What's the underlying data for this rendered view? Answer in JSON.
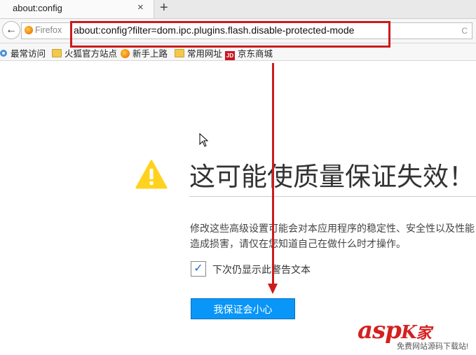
{
  "tab": {
    "title": "about:config",
    "close_glyph": "×",
    "new_tab_glyph": "+"
  },
  "navbar": {
    "back_glyph": "←",
    "identity_label": "Firefox",
    "url": "about:config?filter=dom.ipc.plugins.flash.disable-protected-mode",
    "right_glyph": "C"
  },
  "bookmarks": [
    {
      "label": "最常访问",
      "icon": "gear-icon"
    },
    {
      "label": "火狐官方站点",
      "icon": "folder-icon"
    },
    {
      "label": "新手上路",
      "icon": "firefox-icon"
    },
    {
      "label": "常用网址",
      "icon": "folder-icon"
    },
    {
      "label": "京东商城",
      "icon": "jd-icon",
      "icon_text": "JD"
    }
  ],
  "warning": {
    "title": "这可能使质量保证失效！",
    "description": "修改这些高级设置可能会对本应用程序的稳定性、安全性以及性能造成损害，请仅在您知道自己在做什么时才操作。",
    "checkbox_label": "下次仍显示此警告文本",
    "checkbox_checked": true,
    "button_label": "我保证会小心"
  },
  "watermark": {
    "main": "asp",
    "glyph": "K",
    "suffix": "家",
    "sub": "免费网站源码下载站!"
  },
  "colors": {
    "annotation": "#cc1b1b",
    "button": "#0996f8",
    "warning_icon": "#ffd21e"
  }
}
